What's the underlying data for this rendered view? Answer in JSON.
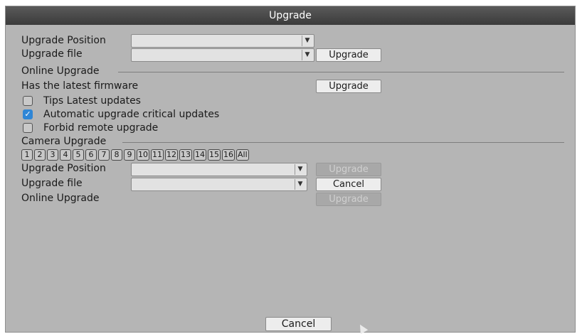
{
  "dialog": {
    "title": "Upgrade"
  },
  "local": {
    "position_label": "Upgrade Position",
    "position_value": "",
    "file_label": "Upgrade file",
    "file_value": "",
    "upgrade_button": "Upgrade"
  },
  "online": {
    "section_label": "Online Upgrade",
    "latest_label": "Has the latest firmware",
    "upgrade_button": "Upgrade",
    "options": [
      {
        "label": "Tips Latest updates",
        "checked": false
      },
      {
        "label": "Automatic upgrade critical updates",
        "checked": true
      },
      {
        "label": "Forbid remote upgrade",
        "checked": false
      }
    ]
  },
  "camera": {
    "section_label": "Camera Upgrade",
    "channels": [
      "1",
      "2",
      "3",
      "4",
      "5",
      "6",
      "7",
      "8",
      "9",
      "10",
      "11",
      "12",
      "13",
      "14",
      "15",
      "16",
      "All"
    ],
    "position_label": "Upgrade Position",
    "position_value": "",
    "upgrade_button": "Upgrade",
    "file_label": "Upgrade file",
    "file_value": "",
    "cancel_button": "Cancel",
    "online_label": "Online Upgrade",
    "online_button": "Upgrade"
  },
  "footer": {
    "cancel_button": "Cancel"
  },
  "icons": {
    "dropdown": "chevron-down-icon",
    "check": "checkmark-icon",
    "cursor": "mouse-pointer-icon"
  },
  "colors": {
    "title_bar": "#3b3b3b",
    "panel": "#b5b5b5",
    "checkbox_on": "#2f86d6"
  }
}
